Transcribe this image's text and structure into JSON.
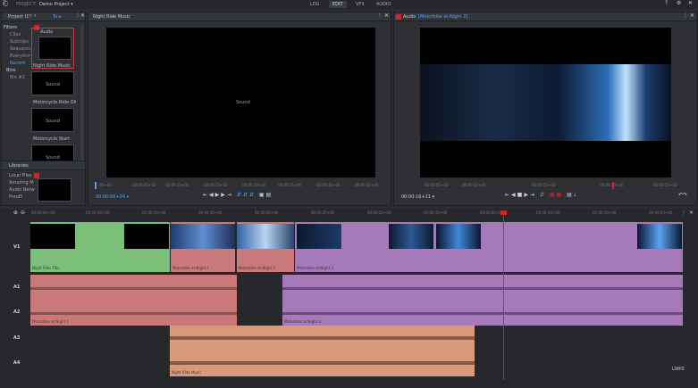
{
  "app": {
    "project_prefix": "PROJECT:",
    "project_name": "Demo Project ▾"
  },
  "tabs": [
    {
      "label": "LOG",
      "active": false
    },
    {
      "label": "EDIT",
      "active": true
    },
    {
      "label": "VFX",
      "active": false
    },
    {
      "label": "AUDIO",
      "active": false
    }
  ],
  "project_panel": {
    "title": "Project (C",
    "to_label": "To ▸",
    "sections": [
      {
        "label": "Filters",
        "items": [
          "Clips",
          "Subclips",
          "Sequences",
          "Everything",
          "Recent"
        ]
      },
      {
        "label": "Bins",
        "items": [
          "Bin #1"
        ]
      }
    ],
    "thumbs": [
      {
        "label": "Audio",
        "caption": ""
      },
      {
        "label": "Night Ride Music",
        "caption": "Sound"
      },
      {
        "label": "Motorcycle Ride Off",
        "caption": "Sound"
      },
      {
        "label": "Motorcycle Start",
        "caption": "Sound"
      }
    ],
    "libraries_title": "Libraries",
    "libraries": [
      "Local Files",
      "Amazing M",
      "Audio Netw",
      "Pond5"
    ]
  },
  "source_viewer": {
    "title": "Night Ride Music",
    "center_label": "Sound",
    "timecode": "00:00:00+04 ▾",
    "ruler": [
      "00+00",
      "00:00:05+00",
      "00:00:10+00",
      "00:00:15+00",
      "00:00:20+00",
      "00:00:25+00",
      "00:00:30+00",
      "00:00:35+00",
      "00:00:40+00"
    ]
  },
  "record_viewer": {
    "title_prefix": "Audio",
    "title_highlight": "[Motorbike at Night 2]",
    "timecode": "00:00:16+11 ▾",
    "ruler": [
      "00:00:05+00",
      "00:00:10+00",
      "00:00:15+00",
      "00:00:20+00",
      "00:00:25+00"
    ]
  },
  "timeline": {
    "ruler": [
      "00:00:00+00",
      "00:00:05+00",
      "00:00:10+00",
      "00:00:15+00",
      "00:00:20+00",
      "00:00:25+00",
      "00:00:30+00",
      "00:00:35+00",
      "00:00:40+00",
      "00:00:45+00",
      "00:00:50+00",
      "00:00:55+00"
    ],
    "tracks": [
      "V1",
      "A1",
      "A2",
      "A3",
      "A4"
    ],
    "video_clips": [
      {
        "name": "Night Ride Title",
        "color": "#7bbf7b"
      },
      {
        "name": "Motorbike at Night 1",
        "color": "#c97979"
      },
      {
        "name": "Motorbike at Night 2",
        "color": "#c97979"
      },
      {
        "name": "Motorbike at Night 3",
        "color": "#a67ab8"
      }
    ],
    "audio_clips_a1a2": [
      {
        "name": "Motorbike at Night 1",
        "color": "#c97979"
      },
      {
        "name": "Motorbike at Night 3",
        "color": "#a67ab8"
      }
    ],
    "audio_clip_a3a4": {
      "name": "Night Ride Music",
      "color": "#d9997a"
    },
    "watermark": "LWKS"
  },
  "colors": {
    "playhead": "#d2232a",
    "accent": "#4aa3ff"
  }
}
